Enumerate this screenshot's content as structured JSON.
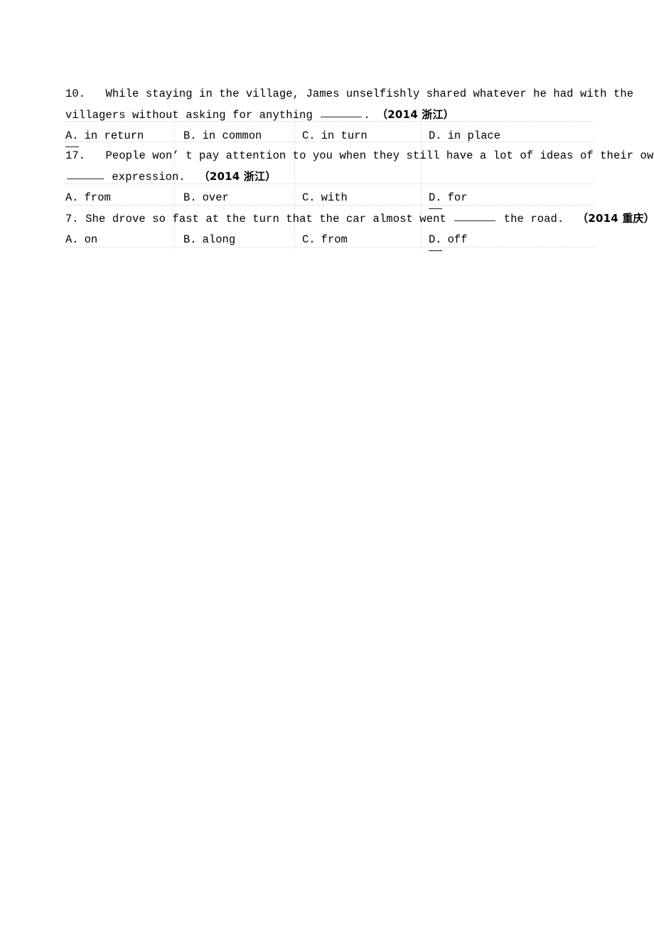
{
  "document": {
    "type": "exam-worksheet",
    "language": "en-zh",
    "page_background": "#ffffff",
    "text_color": "#000000",
    "grid_line_color": "#d9d2d2"
  },
  "questions": [
    {
      "number": "10.",
      "stem_line_1": "While staying in the village, James unselfishly shared whatever he had with the",
      "stem_line_2_before": "villagers  without asking for anything",
      "stem_line_2_after": ".",
      "source": "（2014 浙江）",
      "correct": "A",
      "options": [
        {
          "letter": "A.",
          "text": "in return"
        },
        {
          "letter": "B.",
          "text": "in common"
        },
        {
          "letter": "C.",
          "text": "in turn"
        },
        {
          "letter": "D.",
          "text": "in place"
        }
      ]
    },
    {
      "number": "17.",
      "stem_line_1": "People won’ t pay attention to you when they still have a lot of ideas of their own crying",
      "stem_line_2_before": "",
      "stem_line_2_after": "expression.",
      "source": "（2014 浙江）",
      "correct": "D",
      "options": [
        {
          "letter": "A.",
          "text": "from"
        },
        {
          "letter": "B.",
          "text": "over"
        },
        {
          "letter": "C.",
          "text": "with"
        },
        {
          "letter": "D.",
          "text": "for"
        }
      ]
    },
    {
      "number": "7.",
      "stem_line_1_before": "She drove so fast at the turn that the car almost went",
      "stem_line_1_after": "the road.",
      "source": "（2014 重庆）",
      "correct": "D",
      "options": [
        {
          "letter": "A.",
          "text": "on"
        },
        {
          "letter": "B.",
          "text": "along"
        },
        {
          "letter": "C.",
          "text": "from"
        },
        {
          "letter": "D.",
          "text": "off"
        }
      ]
    }
  ]
}
